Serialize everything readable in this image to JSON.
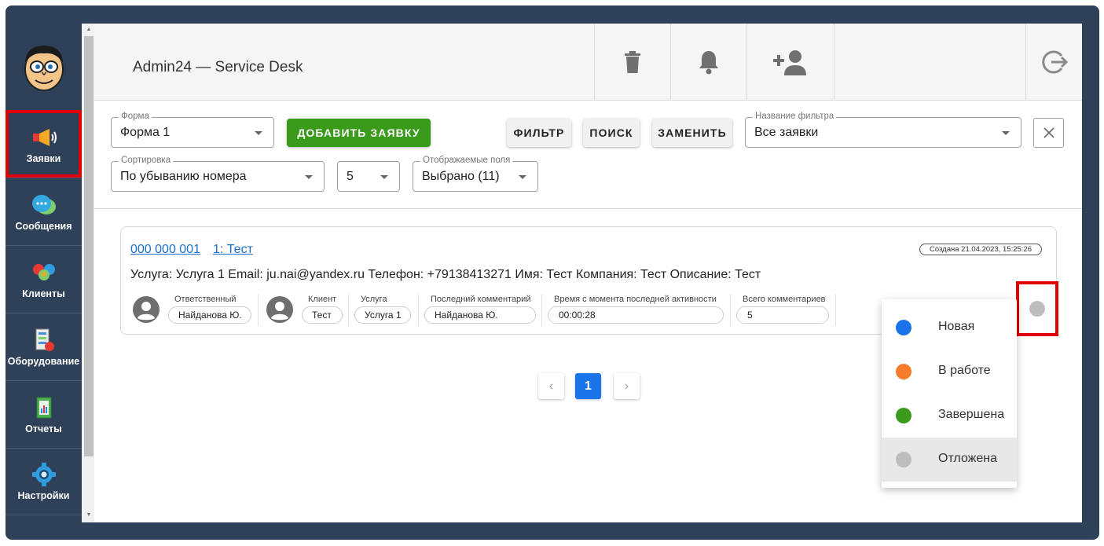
{
  "sidebar": {
    "items": [
      {
        "label": "Заявки",
        "icon": "megaphone-icon"
      },
      {
        "label": "Сообщения",
        "icon": "chat-bubbles-icon"
      },
      {
        "label": "Клиенты",
        "icon": "clients-icon"
      },
      {
        "label": "Оборудование",
        "icon": "equipment-icon"
      },
      {
        "label": "Отчеты",
        "icon": "reports-icon"
      },
      {
        "label": "Настройки",
        "icon": "gear-icon"
      }
    ]
  },
  "header": {
    "title": "Admin24 — Service Desk",
    "icons": [
      "trash-icon",
      "bell-icon",
      "add-user-icon",
      "logout-icon"
    ]
  },
  "filters": {
    "form": {
      "label": "Форма",
      "value": "Форма 1"
    },
    "add_button": "ДОБАВИТЬ ЗАЯВКУ",
    "filter_button": "ФИЛЬТР",
    "search_button": "ПОИСК",
    "replace_button": "ЗАМЕНИТЬ",
    "filter_name": {
      "label": "Название фильтра",
      "value": "Все заявки"
    },
    "sort": {
      "label": "Сортировка",
      "value": "По убыванию номера"
    },
    "page_size": "5",
    "fields": {
      "label": "Отображаемые поля",
      "value": "Выбрано (11)"
    }
  },
  "ticket": {
    "number": "000 000 001",
    "title": "1: Тест",
    "created": "Создана 21.04.2023, 15:25:26",
    "description": "Услуга: Услуга 1 Email: ju.nai@yandex.ru Телефон: +79138413271 Имя: Тест Компания: Тест Описание: Тест",
    "responsible": {
      "label": "Ответственный",
      "value": "Найданова Ю."
    },
    "client": {
      "label": "Клиент",
      "value": "Тест"
    },
    "service": {
      "label": "Услуга",
      "value": "Услуга 1"
    },
    "last_comment": {
      "label": "Последний комментарий",
      "value": "Найданова Ю."
    },
    "activity_time": {
      "label": "Время с момента последней активности",
      "value": "00:00:28"
    },
    "comments_total": {
      "label": "Всего комментариев",
      "value": "5"
    },
    "status_color": "#bdbdbd"
  },
  "pagination": {
    "prev": "‹",
    "current": "1",
    "next": "›"
  },
  "status_menu": [
    {
      "label": "Новая",
      "color": "#1a73e8"
    },
    {
      "label": "В работе",
      "color": "#f57c2b"
    },
    {
      "label": "Завершена",
      "color": "#3a9a1a"
    },
    {
      "label": "Отложена",
      "color": "#bdbdbd"
    }
  ],
  "colors": {
    "sidebar_bg": "#2f4159",
    "accent_green": "#3a9a1a",
    "accent_blue": "#1a73e8",
    "highlight_red": "#e00000"
  }
}
